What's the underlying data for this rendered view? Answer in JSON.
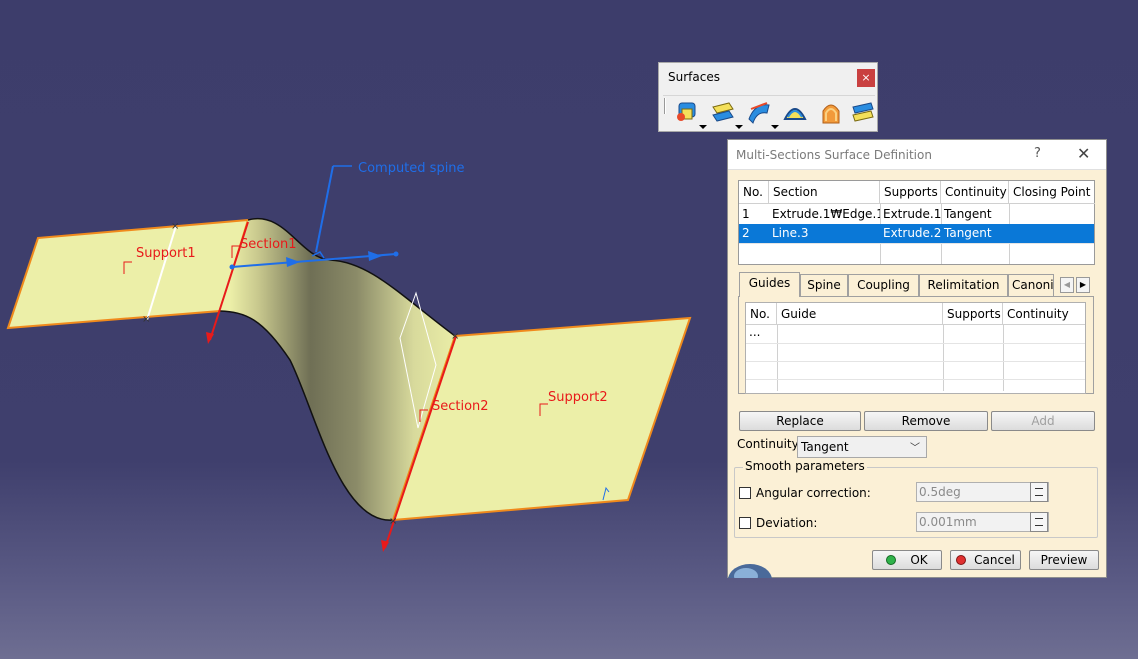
{
  "viewport": {
    "labels": {
      "computed_spine": "Computed spine",
      "support1": "Support1",
      "support2": "Support2",
      "section1": "Section1",
      "section2": "Section2"
    },
    "colors": {
      "surface_fill": "#ecefa8",
      "surface_edge": "#f08a1c",
      "section_red": "#e81a1a",
      "spine_blue": "#1f6ee8"
    }
  },
  "toolbar": {
    "title": "Surfaces",
    "close_label": "×",
    "icons": [
      "extrude-icon",
      "offset-icon",
      "sweep-icon",
      "fill-icon",
      "multi-sections-surface-icon",
      "blend-icon"
    ]
  },
  "dialog": {
    "title": "Multi-Sections Surface Definition",
    "help_label": "?",
    "close_label": "✕",
    "sections_table": {
      "headers": [
        "No.",
        "Section",
        "Supports",
        "Continuity",
        "Closing Point"
      ],
      "rows": [
        {
          "no": "1",
          "section": "Extrude.1₩Edge.1",
          "supports": "Extrude.1",
          "continuity": "Tangent",
          "closing_point": ""
        },
        {
          "no": "2",
          "section": "Line.3",
          "supports": "Extrude.2",
          "continuity": "Tangent",
          "closing_point": ""
        }
      ],
      "selected_row": 2
    },
    "tabs": [
      "Guides",
      "Spine",
      "Coupling",
      "Relimitation",
      "Canonic"
    ],
    "active_tab": "Guides",
    "guides_table": {
      "headers": [
        "No.",
        "Guide",
        "Supports",
        "Continuity"
      ],
      "rows": [
        {
          "no": "...",
          "guide": "",
          "supports": "",
          "continuity": ""
        }
      ]
    },
    "buttons": {
      "replace": "Replace",
      "remove": "Remove",
      "add": "Add"
    },
    "continuity": {
      "label": "Continuity:",
      "value": "Tangent"
    },
    "smooth": {
      "title": "Smooth parameters",
      "angular_label": "Angular correction:",
      "angular_value": "0.5deg",
      "deviation_label": "Deviation:",
      "deviation_value": "0.001mm"
    },
    "footer": {
      "ok": "OK",
      "cancel": "Cancel",
      "preview": "Preview"
    },
    "colors": {
      "panel_bg": "#fbf0d6",
      "selection": "#0a78d7",
      "ok_dot": "#2fb24a",
      "cancel_dot": "#e03030"
    }
  }
}
